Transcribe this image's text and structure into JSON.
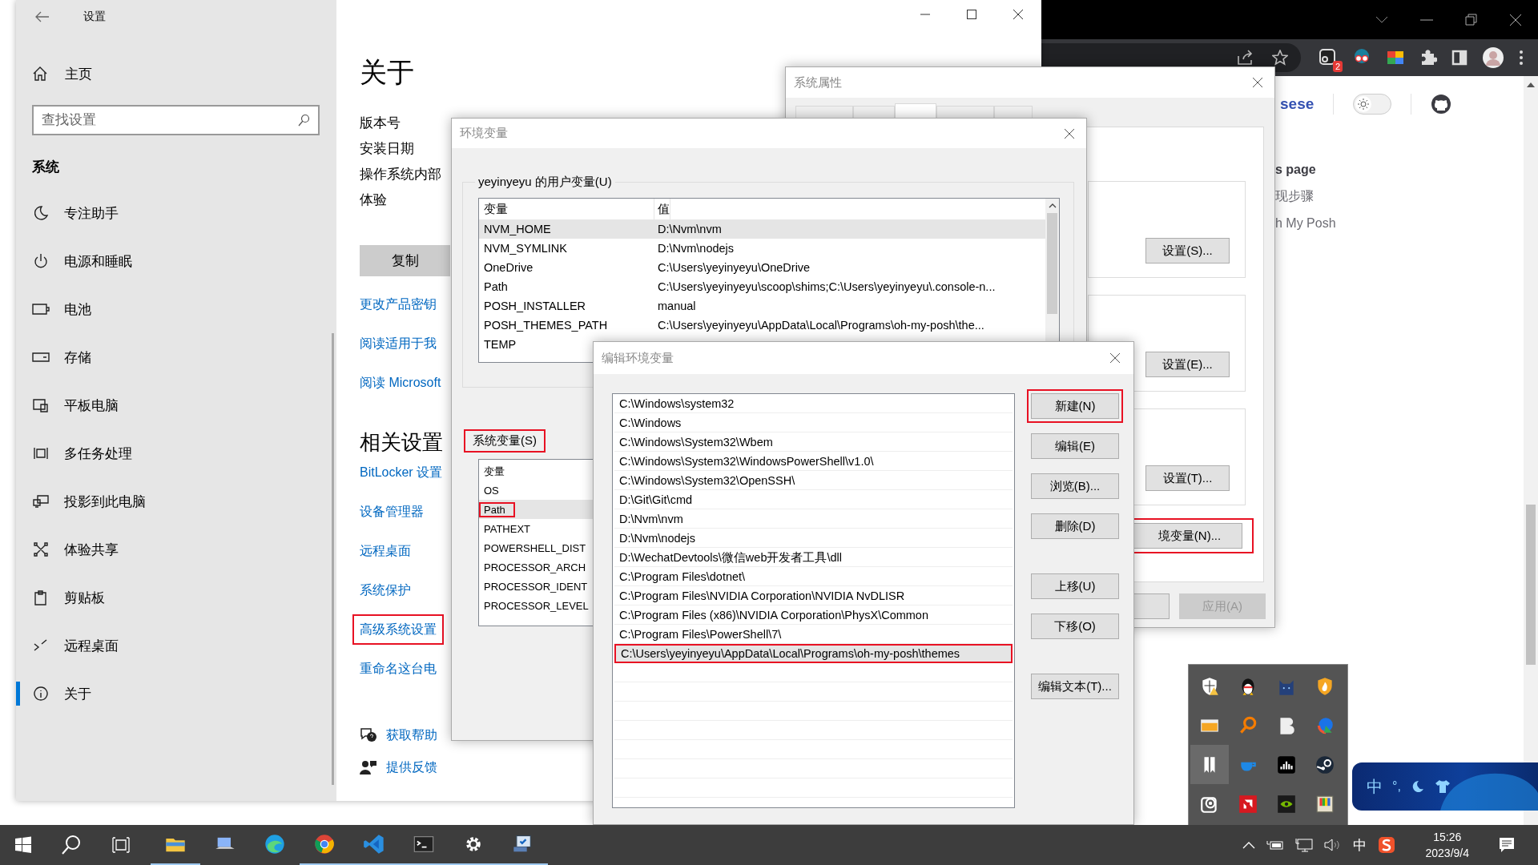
{
  "settings": {
    "title": "设置",
    "home": "主页",
    "search": {
      "placeholder": "查找设置"
    },
    "section": "系统",
    "nav": [
      {
        "label": "专注助手",
        "selected": false
      },
      {
        "label": "电源和睡眠",
        "selected": false
      },
      {
        "label": "电池",
        "selected": false
      },
      {
        "label": "存储",
        "selected": false
      },
      {
        "label": "平板电脑",
        "selected": false
      },
      {
        "label": "多任务处理",
        "selected": false
      },
      {
        "label": "投影到此电脑",
        "selected": false
      },
      {
        "label": "体验共享",
        "selected": false
      },
      {
        "label": "剪贴板",
        "selected": false
      },
      {
        "label": "远程桌面",
        "selected": false
      },
      {
        "label": "关于",
        "selected": true
      }
    ],
    "page_title": "关于",
    "specs": [
      "版本号",
      "安装日期",
      "操作系统内部",
      "体验"
    ],
    "copy_button": "复制",
    "links": [
      "更改产品密钥",
      "阅读适用于我",
      "阅读 Microsoft"
    ],
    "related_title": "相关设置",
    "related_links": [
      {
        "label": "BitLocker 设置",
        "highlighted": false
      },
      {
        "label": "设备管理器",
        "highlighted": false
      },
      {
        "label": "远程桌面",
        "highlighted": false
      },
      {
        "label": "系统保护",
        "highlighted": false
      },
      {
        "label": "高级系统设置",
        "highlighted": true
      },
      {
        "label": "重命名这台电",
        "highlighted": false
      }
    ],
    "help": [
      "获取帮助",
      "提供反馈"
    ]
  },
  "system_properties": {
    "title": "系统属性",
    "tabs": [
      {
        "selected": false
      },
      {
        "selected": false
      },
      {
        "selected": true
      },
      {
        "selected": false
      },
      {
        "selected": false
      }
    ],
    "group_buttons": [
      "设置(S)...",
      "设置(E)...",
      "设置(T)..."
    ],
    "env_button": {
      "label": "境变量(N)...",
      "highlighted": true
    },
    "apply_button": {
      "label": "应用(A)",
      "disabled": true
    }
  },
  "env_dialog": {
    "title": "环境变量",
    "user_group": "yeyinyeyu 的用户变量(U)",
    "user_columns": [
      "变量",
      "值"
    ],
    "user_vars": [
      {
        "name": "NVM_HOME",
        "value": "D:\\Nvm\\nvm",
        "selected": true
      },
      {
        "name": "NVM_SYMLINK",
        "value": "D:\\Nvm\\nodejs",
        "selected": false
      },
      {
        "name": "OneDrive",
        "value": "C:\\Users\\yeyinyeyu\\OneDrive",
        "selected": false
      },
      {
        "name": "Path",
        "value": "C:\\Users\\yeyinyeyu\\scoop\\shims;C:\\Users\\yeyinyeyu\\.console-n...",
        "selected": false
      },
      {
        "name": "POSH_INSTALLER",
        "value": "manual",
        "selected": false
      },
      {
        "name": "POSH_THEMES_PATH",
        "value": "C:\\Users\\yeyinyeyu\\AppData\\Local\\Programs\\oh-my-posh\\the...",
        "selected": false
      },
      {
        "name": "TEMP",
        "selected": false
      }
    ],
    "system_label": {
      "label": "系统变量(S)",
      "highlighted": true
    },
    "system_columns": [
      "变量"
    ],
    "system_vars": [
      {
        "name": "OS",
        "selected": false,
        "highlighted": false
      },
      {
        "name": "Path",
        "selected": true,
        "highlighted": true
      },
      {
        "name": "PATHEXT",
        "selected": false,
        "highlighted": false
      },
      {
        "name": "POWERSHELL_DIST",
        "selected": false,
        "highlighted": false
      },
      {
        "name": "PROCESSOR_ARCH",
        "selected": false,
        "highlighted": false
      },
      {
        "name": "PROCESSOR_IDENT",
        "selected": false,
        "highlighted": false
      },
      {
        "name": "PROCESSOR_LEVEL",
        "selected": false,
        "highlighted": false
      }
    ]
  },
  "edit_dialog": {
    "title": "编辑环境变量",
    "entries": [
      {
        "text": "C:\\Windows\\system32",
        "selected": false,
        "highlighted": false
      },
      {
        "text": "C:\\Windows",
        "selected": false,
        "highlighted": false
      },
      {
        "text": "C:\\Windows\\System32\\Wbem",
        "selected": false,
        "highlighted": false
      },
      {
        "text": "C:\\Windows\\System32\\WindowsPowerShell\\v1.0\\",
        "selected": false,
        "highlighted": false
      },
      {
        "text": "C:\\Windows\\System32\\OpenSSH\\",
        "selected": false,
        "highlighted": false
      },
      {
        "text": "D:\\Git\\Git\\cmd",
        "selected": false,
        "highlighted": false
      },
      {
        "text": "D:\\Nvm\\nvm",
        "selected": false,
        "highlighted": false
      },
      {
        "text": "D:\\Nvm\\nodejs",
        "selected": false,
        "highlighted": false
      },
      {
        "text": "D:\\WechatDevtools\\微信web开发者工具\\dll",
        "selected": false,
        "highlighted": false
      },
      {
        "text": "C:\\Program Files\\dotnet\\",
        "selected": false,
        "highlighted": false
      },
      {
        "text": "C:\\Program Files\\NVIDIA Corporation\\NVIDIA NvDLISR",
        "selected": false,
        "highlighted": false
      },
      {
        "text": "C:\\Program Files (x86)\\NVIDIA Corporation\\PhysX\\Common",
        "selected": false,
        "highlighted": false
      },
      {
        "text": "C:\\Program Files\\PowerShell\\7\\",
        "selected": false,
        "highlighted": false
      },
      {
        "text": "C:\\Users\\yeyinyeyu\\AppData\\Local\\Programs\\oh-my-posh\\themes",
        "selected": true,
        "highlighted": true
      }
    ],
    "buttons": [
      {
        "label": "新建(N)",
        "highlighted": true
      },
      {
        "label": "编辑(E)",
        "highlighted": false
      },
      {
        "label": "浏览(B)...",
        "highlighted": false
      },
      {
        "label": "删除(D)",
        "highlighted": false
      },
      {
        "label": "上移(U)",
        "highlighted": false
      },
      {
        "label": "下移(O)",
        "highlighted": false
      },
      {
        "label": "编辑文本(T)...",
        "highlighted": false
      }
    ]
  },
  "browser": {
    "badge": "2",
    "nav_link": "sese",
    "theme_toggle": {
      "on": false
    },
    "outline": [
      {
        "text": "s page",
        "kind": "heading"
      },
      {
        "text": "现步骤",
        "kind": "item"
      },
      {
        "text": "h My Posh",
        "kind": "item"
      }
    ]
  },
  "tray": {
    "icons": [
      {
        "highlighted": false
      },
      {
        "highlighted": false
      },
      {
        "highlighted": false
      },
      {
        "highlighted": false
      },
      {
        "highlighted": false
      },
      {
        "highlighted": false
      },
      {
        "highlighted": false
      },
      {
        "highlighted": false
      },
      {
        "highlighted": true
      },
      {
        "highlighted": false
      },
      {
        "highlighted": false
      },
      {
        "highlighted": false
      },
      {
        "highlighted": false
      },
      {
        "highlighted": false
      },
      {
        "highlighted": false
      },
      {
        "highlighted": false
      }
    ]
  },
  "ime_bar": {
    "mode": "中",
    "punct": "°,"
  },
  "taskbar": {
    "apps": [
      {
        "running": true
      },
      {
        "running": false
      },
      {
        "running": false
      },
      {
        "running": true
      },
      {
        "running": true
      },
      {
        "running": true
      },
      {
        "running": true
      },
      {
        "running": true
      }
    ],
    "ime": "中",
    "time": "15:26",
    "date": "2023/9/4"
  }
}
